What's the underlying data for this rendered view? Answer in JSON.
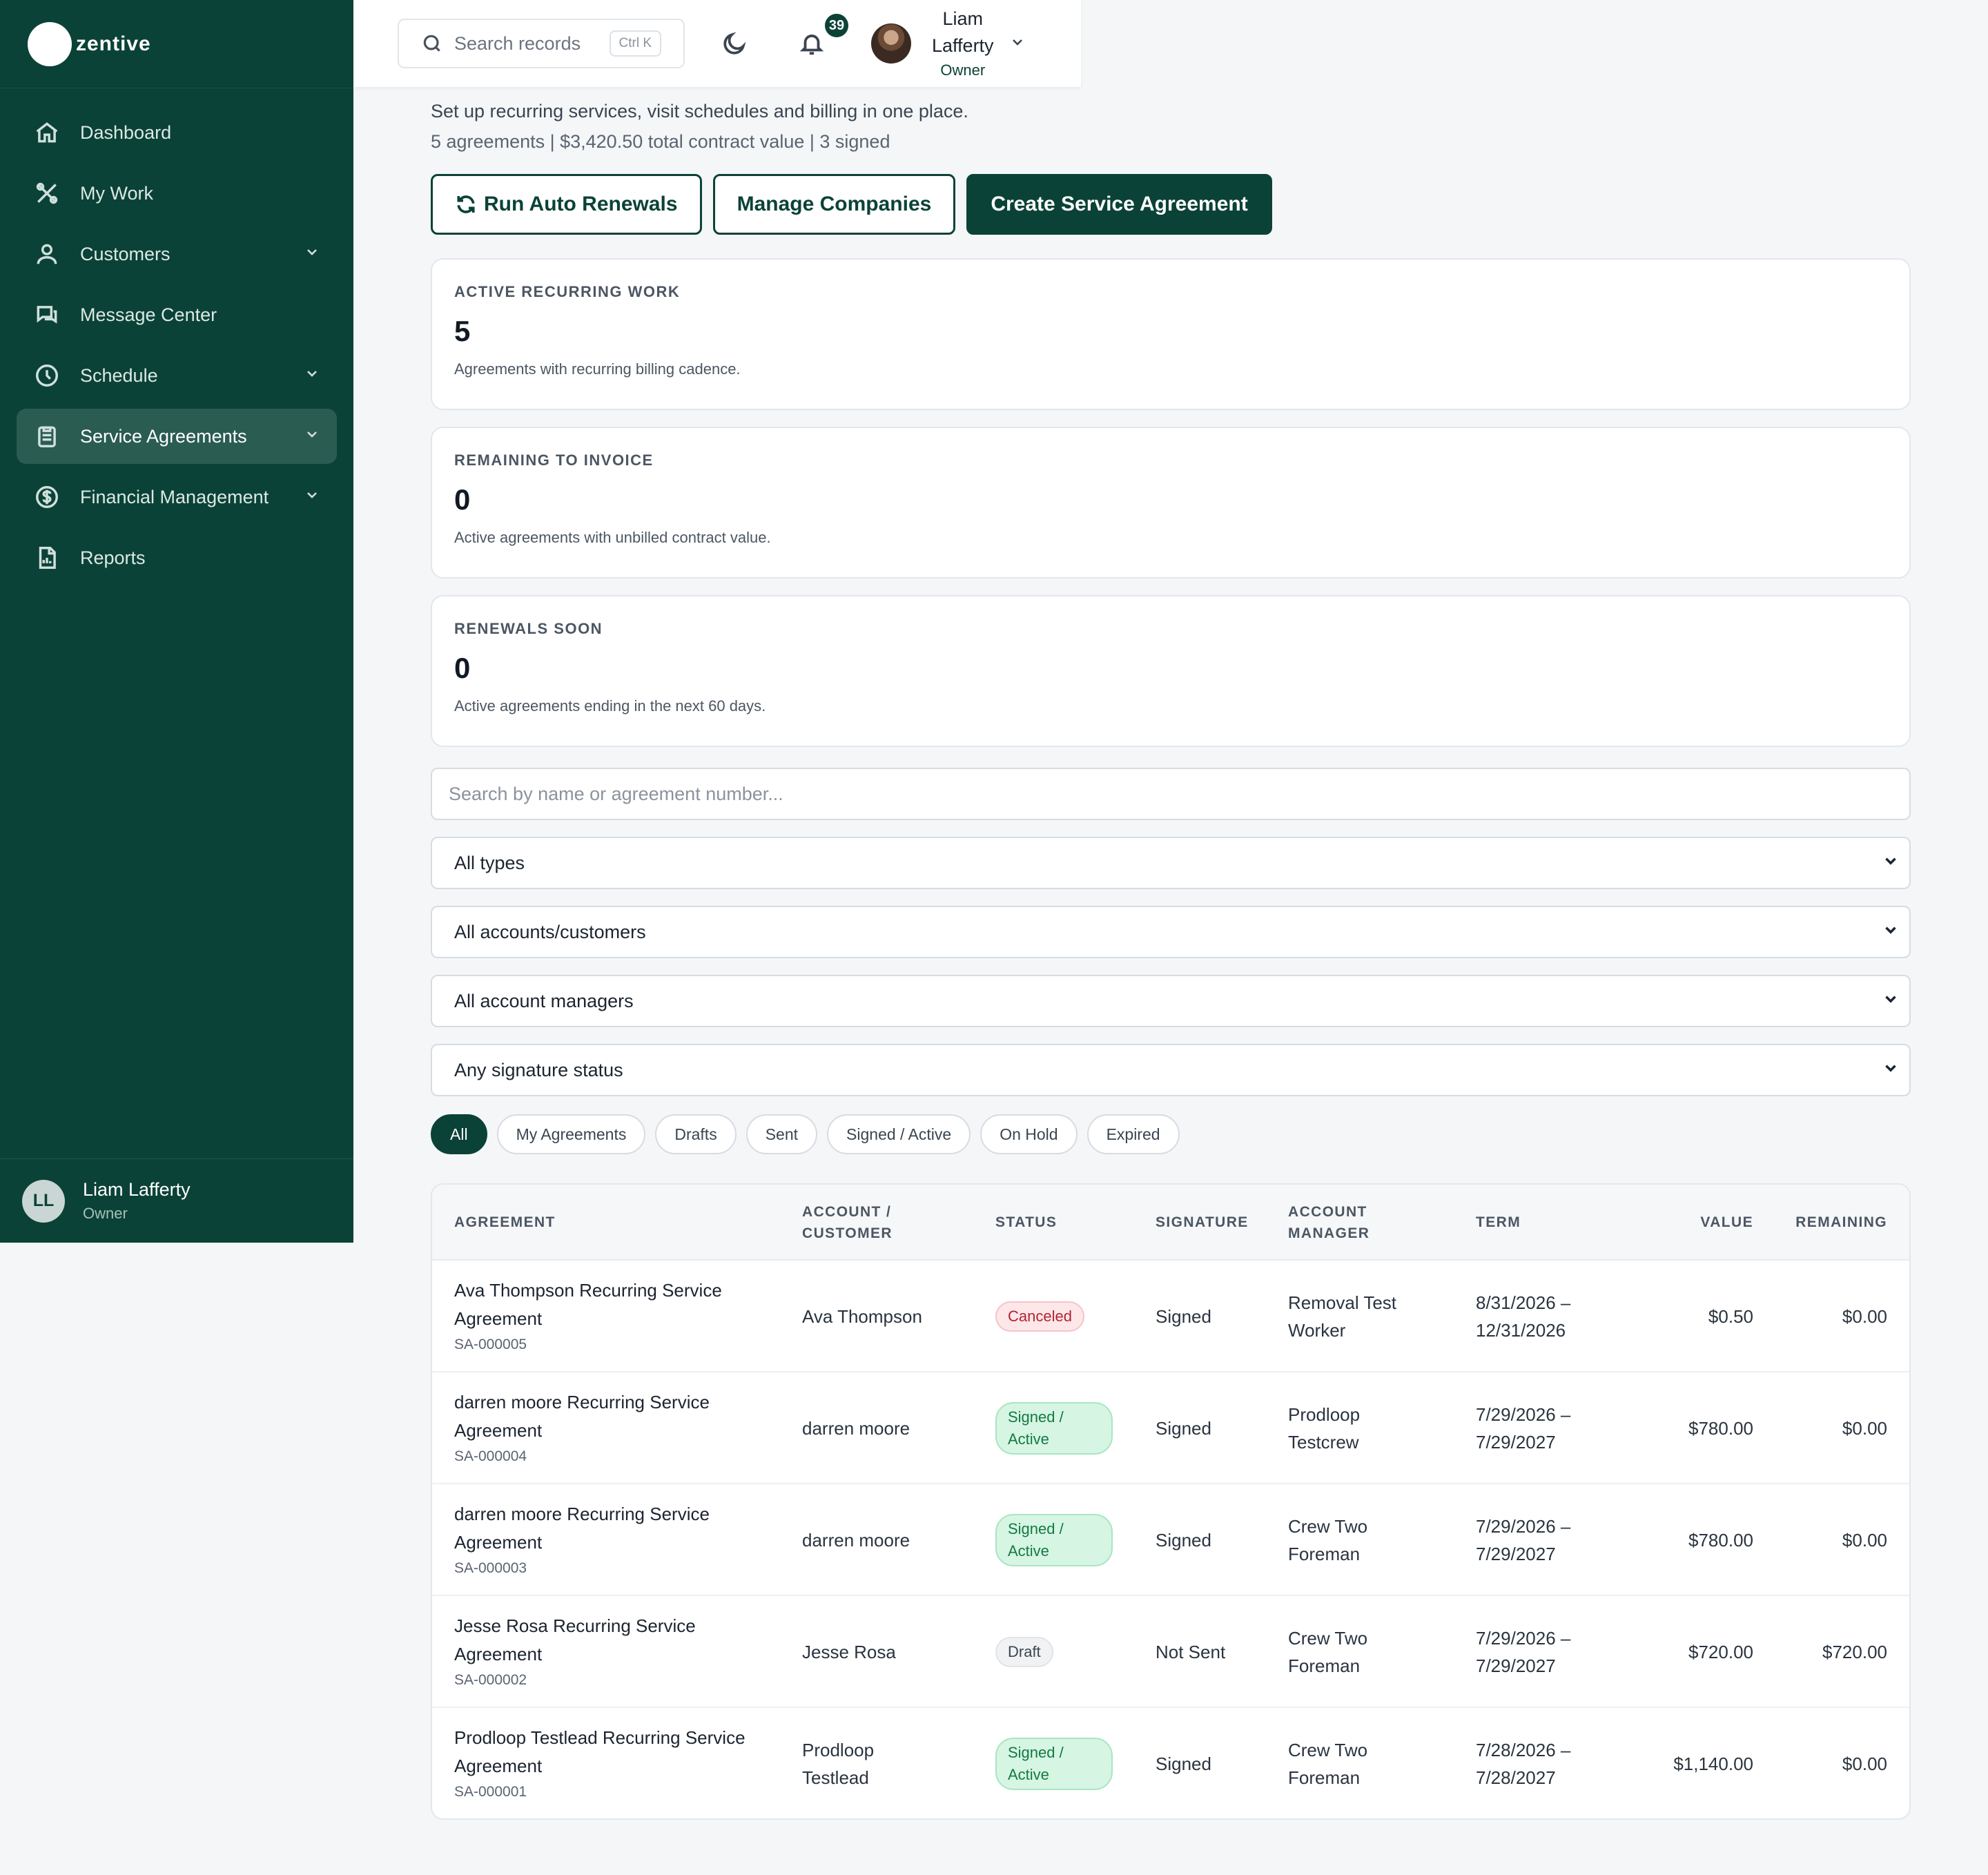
{
  "brand": {
    "name": "zentive"
  },
  "sidebar": {
    "items": [
      {
        "label": "Dashboard",
        "icon": "home-icon",
        "expandable": false,
        "active": false
      },
      {
        "label": "My Work",
        "icon": "tools-icon",
        "expandable": false,
        "active": false
      },
      {
        "label": "Customers",
        "icon": "users-icon",
        "expandable": true,
        "active": false
      },
      {
        "label": "Message Center",
        "icon": "chat-icon",
        "expandable": false,
        "active": false
      },
      {
        "label": "Schedule",
        "icon": "clock-icon",
        "expandable": true,
        "active": false
      },
      {
        "label": "Service Agreements",
        "icon": "clipboard-icon",
        "expandable": true,
        "active": true
      },
      {
        "label": "Financial Management",
        "icon": "dollar-icon",
        "expandable": true,
        "active": false
      },
      {
        "label": "Reports",
        "icon": "report-icon",
        "expandable": false,
        "active": false
      }
    ],
    "user": {
      "initials": "LL",
      "name": "Liam Lafferty",
      "role": "Owner"
    }
  },
  "topbar": {
    "search_placeholder": "Search records",
    "shortcut": "Ctrl K",
    "notifications_count": "39",
    "user_first": "Liam",
    "user_last": "Lafferty",
    "user_role": "Owner"
  },
  "page": {
    "description": "Set up recurring services, visit schedules and billing in one place.",
    "summary": "5 agreements | $3,420.50 total contract value | 3 signed",
    "actions": {
      "renewals": "Run Auto Renewals",
      "companies": "Manage Companies",
      "create": "Create Service Agreement"
    }
  },
  "stats": [
    {
      "label": "ACTIVE RECURRING WORK",
      "value": "5",
      "help": "Agreements with recurring billing cadence."
    },
    {
      "label": "REMAINING TO INVOICE",
      "value": "0",
      "help": "Active agreements with unbilled contract value."
    },
    {
      "label": "RENEWALS SOON",
      "value": "0",
      "help": "Active agreements ending in the next 60 days."
    }
  ],
  "filters": {
    "search_placeholder": "Search by name or agreement number...",
    "type": "All types",
    "account": "All accounts/customers",
    "manager": "All account managers",
    "signature": "Any signature status"
  },
  "tabs": [
    "All",
    "My Agreements",
    "Drafts",
    "Sent",
    "Signed / Active",
    "On Hold",
    "Expired"
  ],
  "table": {
    "headers": {
      "agreement": "AGREEMENT",
      "account_1": "ACCOUNT /",
      "account_2": "CUSTOMER",
      "status": "STATUS",
      "signature": "SIGNATURE",
      "manager_1": "ACCOUNT",
      "manager_2": "MANAGER",
      "term": "TERM",
      "value": "VALUE",
      "remaining": "REMAINING"
    },
    "rows": [
      {
        "name_1": "Ava Thompson Recurring Service",
        "name_2": "Agreement",
        "id": "SA-000005",
        "account_1": "Ava Thompson",
        "account_2": "",
        "status_1": "Canceled",
        "status_2": "",
        "status_kind": "canceled",
        "signature": "Signed",
        "manager_1": "Removal Test",
        "manager_2": "Worker",
        "term_1": "8/31/2026 –",
        "term_2": "12/31/2026",
        "value": "$0.50",
        "remaining": "$0.00"
      },
      {
        "name_1": "darren moore Recurring Service",
        "name_2": "Agreement",
        "id": "SA-000004",
        "account_1": "darren moore",
        "account_2": "",
        "status_1": "Signed /",
        "status_2": "Active",
        "status_kind": "active",
        "signature": "Signed",
        "manager_1": "Prodloop",
        "manager_2": "Testcrew",
        "term_1": "7/29/2026 –",
        "term_2": "7/29/2027",
        "value": "$780.00",
        "remaining": "$0.00"
      },
      {
        "name_1": "darren moore Recurring Service",
        "name_2": "Agreement",
        "id": "SA-000003",
        "account_1": "darren moore",
        "account_2": "",
        "status_1": "Signed /",
        "status_2": "Active",
        "status_kind": "active",
        "signature": "Signed",
        "manager_1": "Crew Two",
        "manager_2": "Foreman",
        "term_1": "7/29/2026 –",
        "term_2": "7/29/2027",
        "value": "$780.00",
        "remaining": "$0.00"
      },
      {
        "name_1": "Jesse Rosa Recurring Service",
        "name_2": "Agreement",
        "id": "SA-000002",
        "account_1": "Jesse Rosa",
        "account_2": "",
        "status_1": "Draft",
        "status_2": "",
        "status_kind": "draft",
        "signature": "Not Sent",
        "manager_1": "Crew Two",
        "manager_2": "Foreman",
        "term_1": "7/29/2026 –",
        "term_2": "7/29/2027",
        "value": "$720.00",
        "remaining": "$720.00"
      },
      {
        "name_1": "Prodloop Testlead Recurring Service",
        "name_2": "Agreement",
        "id": "SA-000001",
        "account_1": "Prodloop",
        "account_2": "Testlead",
        "status_1": "Signed /",
        "status_2": "Active",
        "status_kind": "active",
        "signature": "Signed",
        "manager_1": "Crew Two",
        "manager_2": "Foreman",
        "term_1": "7/28/2026 –",
        "term_2": "7/28/2027",
        "value": "$1,140.00",
        "remaining": "$0.00"
      }
    ]
  },
  "colors": {
    "brand": "#0b4237",
    "active_status": "#137a44",
    "canceled_status": "#b4232f"
  }
}
